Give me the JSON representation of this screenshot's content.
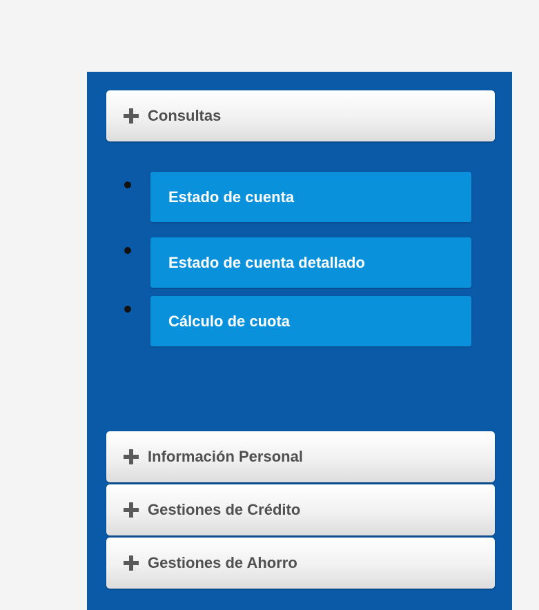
{
  "menu": {
    "consultas": {
      "label": "Consultas",
      "icon": "plus-icon",
      "items": [
        {
          "label": "Estado de cuenta"
        },
        {
          "label": "Estado de cuenta detallado"
        },
        {
          "label": "Cálculo de cuota"
        }
      ]
    },
    "informacion_personal": {
      "label": "Información Personal",
      "icon": "plus-icon"
    },
    "gestiones_credito": {
      "label": "Gestiones de Crédito",
      "icon": "plus-icon"
    },
    "gestiones_ahorro": {
      "label": "Gestiones de Ahorro",
      "icon": "plus-icon"
    }
  },
  "colors": {
    "panel_background": "#0a5aa8",
    "submenu_button": "#0a91db",
    "header_text": "#505050",
    "submenu_text": "#ffffff"
  }
}
